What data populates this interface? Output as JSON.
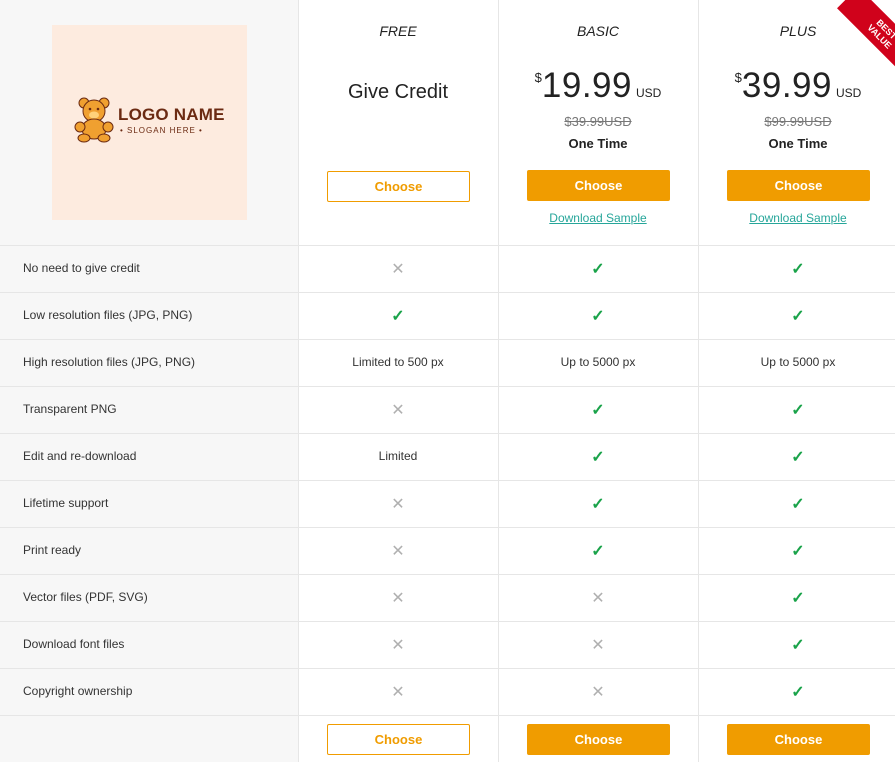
{
  "logo": {
    "name": "LOGO NAME",
    "slogan": "• SLOGAN HERE •"
  },
  "plans": [
    {
      "name": "FREE",
      "headline": "Give Credit",
      "choose_label": "Choose"
    },
    {
      "name": "BASIC",
      "currency": "$",
      "amount": "19.99",
      "unit": "USD",
      "old_price": "$39.99USD",
      "term": "One Time",
      "choose_label": "Choose",
      "sample_label": "Download Sample"
    },
    {
      "name": "PLUS",
      "currency": "$",
      "amount": "39.99",
      "unit": "USD",
      "old_price": "$99.99USD",
      "term": "One Time",
      "choose_label": "Choose",
      "sample_label": "Download Sample"
    }
  ],
  "ribbon": {
    "line1": "BEST",
    "line2": "VALUE"
  },
  "features": [
    {
      "label": "No need to give credit",
      "values": [
        "x",
        "check",
        "check"
      ]
    },
    {
      "label": "Low resolution files (JPG, PNG)",
      "values": [
        "check",
        "check",
        "check"
      ]
    },
    {
      "label": "High resolution files (JPG, PNG)",
      "values": [
        "Limited to 500 px",
        "Up to 5000 px",
        "Up to 5000 px"
      ]
    },
    {
      "label": "Transparent PNG",
      "values": [
        "x",
        "check",
        "check"
      ]
    },
    {
      "label": "Edit and re-download",
      "values": [
        "Limited",
        "check",
        "check"
      ]
    },
    {
      "label": "Lifetime support",
      "values": [
        "x",
        "check",
        "check"
      ]
    },
    {
      "label": "Print ready",
      "values": [
        "x",
        "check",
        "check"
      ]
    },
    {
      "label": "Vector files (PDF, SVG)",
      "values": [
        "x",
        "x",
        "check"
      ]
    },
    {
      "label": "Download font files",
      "values": [
        "x",
        "x",
        "check"
      ]
    },
    {
      "label": "Copyright ownership",
      "values": [
        "x",
        "x",
        "check"
      ]
    }
  ],
  "footer": {
    "choose_labels": [
      "Choose",
      "Choose",
      "Choose"
    ]
  },
  "colors": {
    "accent": "#f09c00",
    "link": "#26a69a",
    "check": "#1aa34a",
    "cross": "#b0b0b0",
    "ribbon": "#d0021b",
    "logo_bg": "#fdebdf",
    "logo_text": "#6b2a12"
  }
}
